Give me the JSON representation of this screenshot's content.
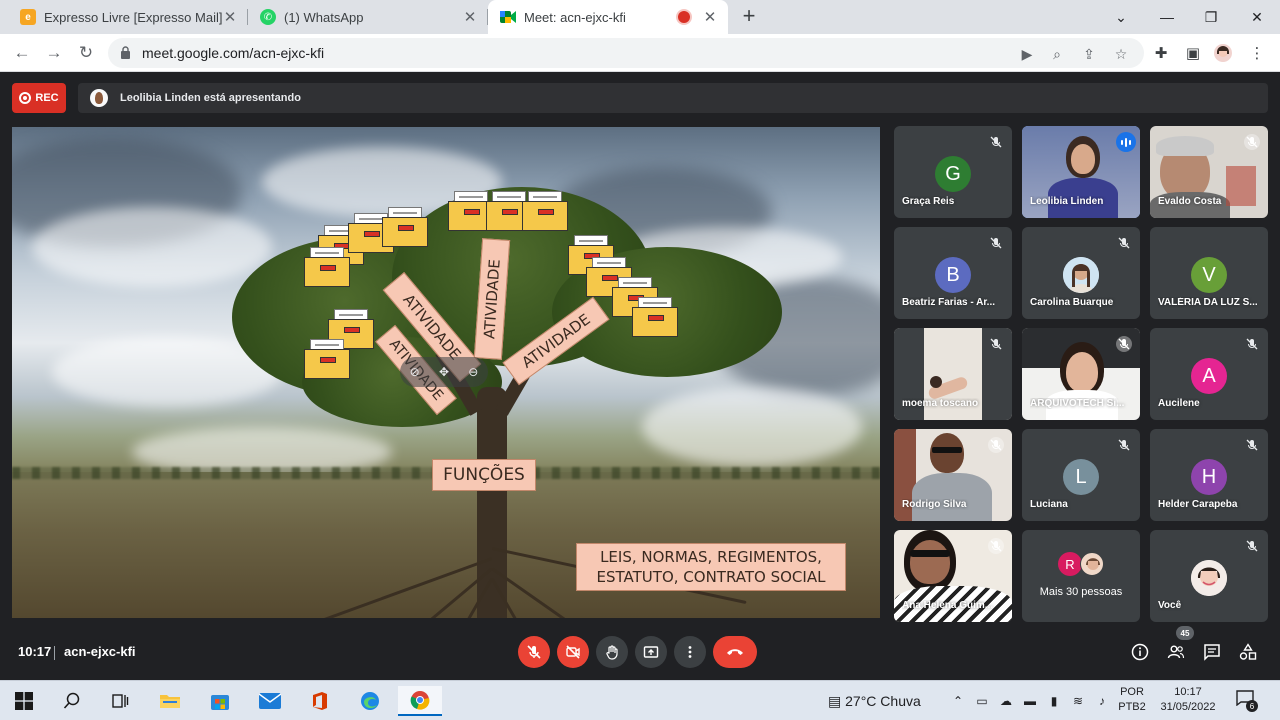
{
  "browser": {
    "tabs": [
      {
        "title": "Expresso Livre [Expresso Mail]",
        "icon": "expresso-icon"
      },
      {
        "title": "(1) WhatsApp",
        "icon": "whatsapp-icon"
      },
      {
        "title": "Meet: acn-ejxc-kfi",
        "icon": "meet-icon",
        "active": true,
        "recording": true
      }
    ],
    "url": "meet.google.com/acn-ejxc-kfi"
  },
  "meet": {
    "rec_label": "REC",
    "presenting_text": "Leolibia Linden está apresentando",
    "slide": {
      "labels": [
        "ATIVIDADE",
        "ATIVIDADE",
        "ATIVIDADE",
        "ATIVIDADE"
      ],
      "functions_label": "FUNÇÕES",
      "laws_line1": "LEIS, NORMAS, REGIMENTOS,",
      "laws_line2": "ESTATUTO, CONTRATO SOCIAL"
    },
    "participants": [
      {
        "name": "Graça Reis",
        "initial": "G",
        "color": "#2e7d32"
      },
      {
        "name": "Leolibia Linden",
        "speaking": true
      },
      {
        "name": "Evaldo Costa"
      },
      {
        "name": "Beatriz Farias - Ar...",
        "initial": "B",
        "color": "#5c6bc0"
      },
      {
        "name": "Carolina Buarque"
      },
      {
        "name": "VALÉRIA DA LUZ S...",
        "initial": "V",
        "color": "#689f38"
      },
      {
        "name": "moema toscano"
      },
      {
        "name": "ARQUIVOTECH Si..."
      },
      {
        "name": "Aucilene",
        "initial": "A",
        "color": "#e52592"
      },
      {
        "name": "Rodrigo Silva"
      },
      {
        "name": "Luciana",
        "initial": "L",
        "color": "#78909c"
      },
      {
        "name": "Helder Carapeba",
        "initial": "H",
        "color": "#8e44ad"
      },
      {
        "name": "Ana Helena Guim..."
      },
      {
        "name": "Mais 30 pessoas",
        "initial": "R",
        "color": "#d81b60"
      },
      {
        "name": "Você"
      }
    ],
    "clock": "10:17",
    "meeting_code": "acn-ejxc-kfi",
    "people_count": "45"
  },
  "taskbar": {
    "weather": "27°C  Chuva",
    "lang_top": "POR",
    "lang_bottom": "PTB2",
    "time": "10:17",
    "date": "31/05/2022",
    "notifications": "6"
  }
}
